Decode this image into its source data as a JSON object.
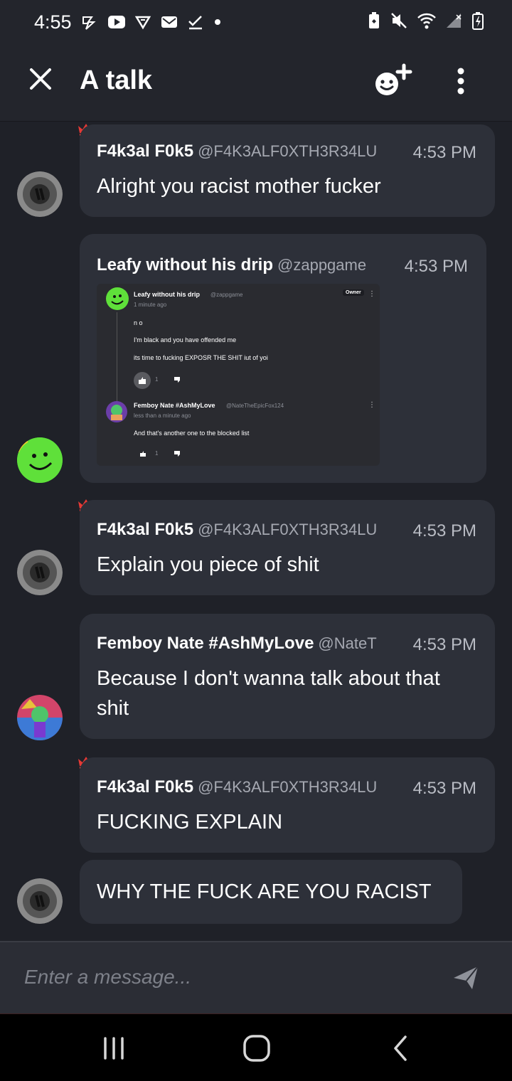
{
  "status_bar": {
    "time": "4:55",
    "left_icons": [
      "lightning-icon",
      "youtube-icon",
      "shield-icon",
      "mail-icon",
      "check-icon",
      "dot-icon"
    ],
    "right_icons": [
      "battery-saver-icon",
      "mute-icon",
      "wifi-icon",
      "signal-icon",
      "battery-charging-icon"
    ]
  },
  "app_bar": {
    "title": "A talk"
  },
  "messages": [
    {
      "name": "F4k3al F0k5",
      "handle": "@F4K3ALF0XTH3R34LU",
      "time": "4:53 PM",
      "text": "Alright you racist mother fucker",
      "owner_crown": true
    },
    {
      "name": "Leafy without his drip",
      "handle": "@zappgame",
      "time": "4:53 PM",
      "embed": {
        "post_author": "Leafy without his drip",
        "post_handle": "@zappgame",
        "post_time": "1 minute ago",
        "owner_badge": "Owner",
        "lines": [
          "n o",
          "I'm black and you have offended me",
          "its time to fucking EXPOSR THE SHIT iut of yoi"
        ],
        "likes": "1",
        "reply_author": "Femboy Nate #AshMyLove",
        "reply_handle": "@NateTheEpicFox124",
        "reply_time": "less than a minute ago",
        "reply_text": "And that's another one to the blocked list",
        "reply_likes": "1"
      }
    },
    {
      "name": "F4k3al F0k5",
      "handle": "@F4K3ALF0XTH3R34LU",
      "time": "4:53 PM",
      "text": "Explain you piece of shit",
      "owner_crown": true
    },
    {
      "name": "Femboy Nate #AshMyLove",
      "handle": "@NateT",
      "time": "4:53 PM",
      "text_line1": "Because I don't wanna talk about that",
      "text_line2": "shit"
    },
    {
      "name": "F4k3al F0k5",
      "handle": "@F4K3ALF0XTH3R34LU",
      "time": "4:53 PM",
      "text": "FUCKING EXPLAIN",
      "owner_crown": true
    },
    {
      "text": "WHY THE FUCK ARE YOU RACIST"
    }
  ],
  "composer": {
    "placeholder": "Enter a message..."
  },
  "colors": {
    "background": "#1f2128",
    "bubble": "#2d3039",
    "crown": "#e53935",
    "handle": "#a5a8b1"
  }
}
